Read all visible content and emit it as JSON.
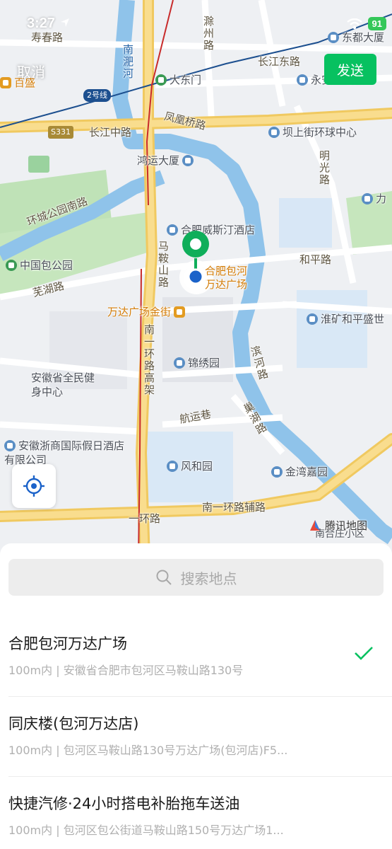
{
  "status": {
    "time": "3:27",
    "battery": "91"
  },
  "toolbar": {
    "cancel_label": "取消",
    "send_label": "发送"
  },
  "map": {
    "labels": {
      "shouchun": "寿春路",
      "nanfei": "南淝河",
      "chuzhou": "滁州路",
      "changjiangdong": "长江东路",
      "dongdu": "东都大厦",
      "yongjiu": "永安广场大厦",
      "baisheng": "百盛",
      "line2": "2号线",
      "dadongmen": "大东门",
      "s331": "S331",
      "changjiangzhong": "长江中路",
      "fenghuangqiao": "凤凰桥路",
      "bashangjie": "坝上街环球中心",
      "hongyun": "鸿运大厦",
      "mingguang": "明光路",
      "li": "力",
      "huancheng": "环城公园南路",
      "weisiting": "合肥威斯汀酒店",
      "baogong": "中国包公园",
      "heping": "和平路",
      "wuhu": "芜湖路",
      "maanshan": "马鞍山路",
      "wanda_name": "合肥包河万达广场",
      "wanda_jinjie": "万达广场金街",
      "huaikuang": "淮矿和平盛世",
      "nanyi": "南一环路高架",
      "jinxiu": "锦绣园",
      "binhe": "滨河路",
      "quanmin": "安徽省全民健身中心",
      "hangyun": "航运巷",
      "chaohu": "巢湖路",
      "zheshang": "安徽浙商国际假日酒店有限公司",
      "fenghe": "风和园",
      "jinwan": "金湾嘉园",
      "nanyihuanfu": "南一环路辅路",
      "yihuan": "一环路",
      "nanhezhuang": "南合庄小区"
    },
    "brand": "腾讯地图"
  },
  "search": {
    "placeholder": "搜索地点"
  },
  "results": [
    {
      "title": "合肥包河万达广场",
      "subtitle": "100m内 | 安徽省合肥市包河区马鞍山路130号",
      "selected": true
    },
    {
      "title": "同庆楼(包河万达店)",
      "subtitle": "100m内 | 包河区马鞍山路130号万达广场(包河店)F5...",
      "selected": false
    },
    {
      "title": "快捷汽修·24小时搭电补胎拖车送油",
      "subtitle": "100m内 | 包河区包公街道马鞍山路150号万达广场1...",
      "selected": false
    }
  ],
  "colors": {
    "accent": "#07c160",
    "pin": "#0fae5a",
    "water": "#8fc3ea",
    "park": "#bfe2b7",
    "road_major": "#f7d67a"
  }
}
